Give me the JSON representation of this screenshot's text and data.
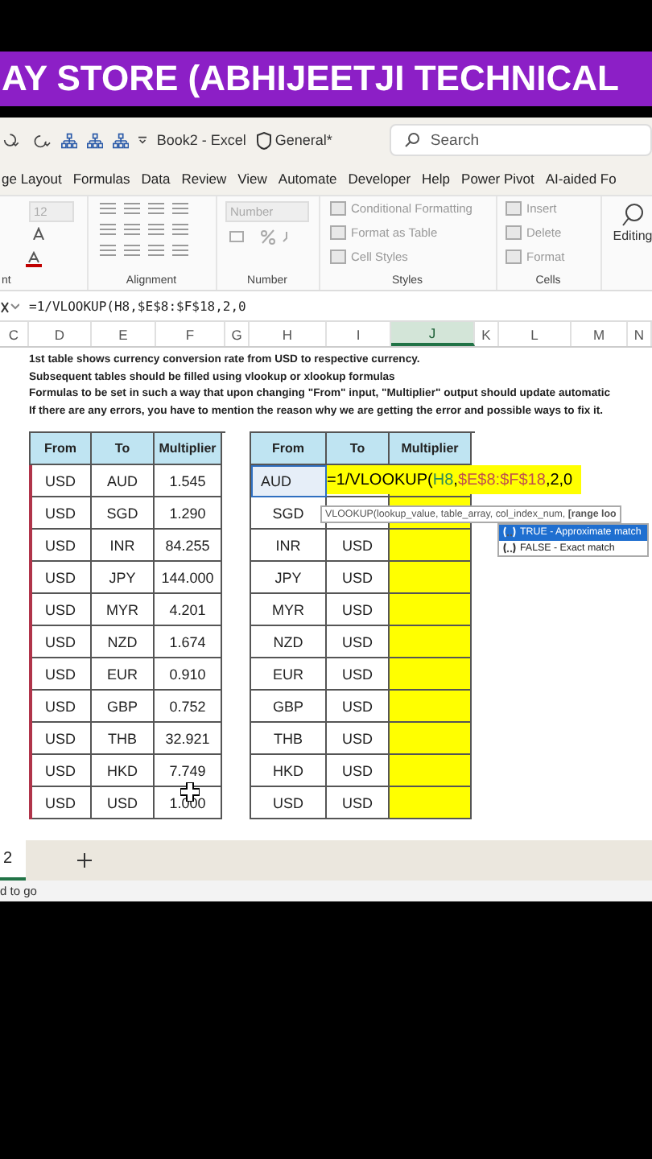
{
  "banner": {
    "title": "AY STORE (ABHIJEETJI TECHNICAL"
  },
  "titlebar": {
    "document": "Book2 - Excel",
    "label": "General*",
    "search": {
      "placeholder": "Search"
    }
  },
  "ribbon_tabs": [
    {
      "label": "ge Layout",
      "selected": false
    },
    {
      "label": "Formulas",
      "selected": false
    },
    {
      "label": "Data",
      "selected": false
    },
    {
      "label": "Review",
      "selected": false
    },
    {
      "label": "View",
      "selected": false
    },
    {
      "label": "Automate",
      "selected": false
    },
    {
      "label": "Developer",
      "selected": false
    },
    {
      "label": "Help",
      "selected": false
    },
    {
      "label": "Power Pivot",
      "selected": false
    },
    {
      "label": "AI-aided Fo",
      "selected": false
    }
  ],
  "ribbon": {
    "font_size": "12",
    "number_format": "Number",
    "styles": [
      "Conditional Formatting",
      "Format as Table",
      "Cell Styles"
    ],
    "cells": [
      "Insert",
      "Delete",
      "Format"
    ],
    "editing": "Editing",
    "group_labels": [
      "nt",
      "Alignment",
      "Number",
      "Styles",
      "Cells"
    ]
  },
  "formula_bar": {
    "formula": "=1/VLOOKUP(H8,$E$8:$F$18,2,0"
  },
  "columns": [
    {
      "label": "C",
      "selected": false
    },
    {
      "label": "D",
      "selected": false
    },
    {
      "label": "E",
      "selected": false
    },
    {
      "label": "F",
      "selected": false
    },
    {
      "label": "G",
      "selected": false
    },
    {
      "label": "H",
      "selected": false
    },
    {
      "label": "I",
      "selected": false
    },
    {
      "label": "J",
      "selected": true
    },
    {
      "label": "K",
      "selected": false
    },
    {
      "label": "L",
      "selected": false
    },
    {
      "label": "M",
      "selected": false
    },
    {
      "label": "N",
      "selected": false
    }
  ],
  "notes": [
    "1st table shows currency conversion rate from USD to respective currency.",
    "Subsequent tables should be filled using vlookup or xlookup formulas",
    "Formulas to be set in such a way that upon changing \"From\" input, \"Multiplier\" output should update automatic",
    "If there are any errors, you have to mention the reason why we are getting the error and possible ways to fix it."
  ],
  "tables": [
    {
      "headers": [
        "From",
        "To",
        "Multiplier"
      ],
      "referenced": true,
      "multiplier_highlighted": false,
      "rows": [
        {
          "from": "USD",
          "to": "AUD",
          "multiplier": "1.545",
          "active": false
        },
        {
          "from": "USD",
          "to": "SGD",
          "multiplier": "1.290",
          "active": false
        },
        {
          "from": "USD",
          "to": "INR",
          "multiplier": "84.255",
          "active": false
        },
        {
          "from": "USD",
          "to": "JPY",
          "multiplier": "144.000",
          "active": false
        },
        {
          "from": "USD",
          "to": "MYR",
          "multiplier": "4.201",
          "active": false
        },
        {
          "from": "USD",
          "to": "NZD",
          "multiplier": "1.674",
          "active": false
        },
        {
          "from": "USD",
          "to": "EUR",
          "multiplier": "0.910",
          "active": false
        },
        {
          "from": "USD",
          "to": "GBP",
          "multiplier": "0.752",
          "active": false
        },
        {
          "from": "USD",
          "to": "THB",
          "multiplier": "32.921",
          "active": false
        },
        {
          "from": "USD",
          "to": "HKD",
          "multiplier": "7.749",
          "active": false
        },
        {
          "from": "USD",
          "to": "USD",
          "multiplier": "1.000",
          "active": false
        }
      ]
    },
    {
      "headers": [
        "From",
        "To",
        "Multiplier"
      ],
      "referenced": false,
      "multiplier_highlighted": true,
      "editing_formula": [
        {
          "text": "=1/VLOOKUP("
        },
        {
          "text": "H8",
          "color": "#2e8b57"
        },
        {
          "text": ","
        },
        {
          "text": "$E$8:$F$18",
          "color": "#c0504d"
        },
        {
          "text": ",2,0"
        }
      ],
      "rows": [
        {
          "from": "AUD",
          "active": true
        },
        {
          "from": "SGD",
          "active": false
        },
        {
          "from": "INR",
          "to": "USD",
          "active": false
        },
        {
          "from": "JPY",
          "to": "USD",
          "active": false
        },
        {
          "from": "MYR",
          "to": "USD",
          "active": false
        },
        {
          "from": "NZD",
          "to": "USD",
          "active": false
        },
        {
          "from": "EUR",
          "to": "USD",
          "active": false
        },
        {
          "from": "GBP",
          "to": "USD",
          "active": false
        },
        {
          "from": "THB",
          "to": "USD",
          "active": false
        },
        {
          "from": "HKD",
          "to": "USD",
          "active": false
        },
        {
          "from": "USD",
          "to": "USD",
          "active": false
        }
      ]
    }
  ],
  "tooltip": {
    "text": "VLOOKUP(lookup_value, table_array, col_index_num, **[range loo**"
  },
  "autocomplete": [
    {
      "label": "TRUE - Approximate match",
      "selected": true
    },
    {
      "label": "FALSE - Exact match",
      "selected": false
    }
  ],
  "sheet_tabs": [
    {
      "label": "2",
      "selected": true
    }
  ],
  "status_bar": {
    "text": "d to go"
  }
}
